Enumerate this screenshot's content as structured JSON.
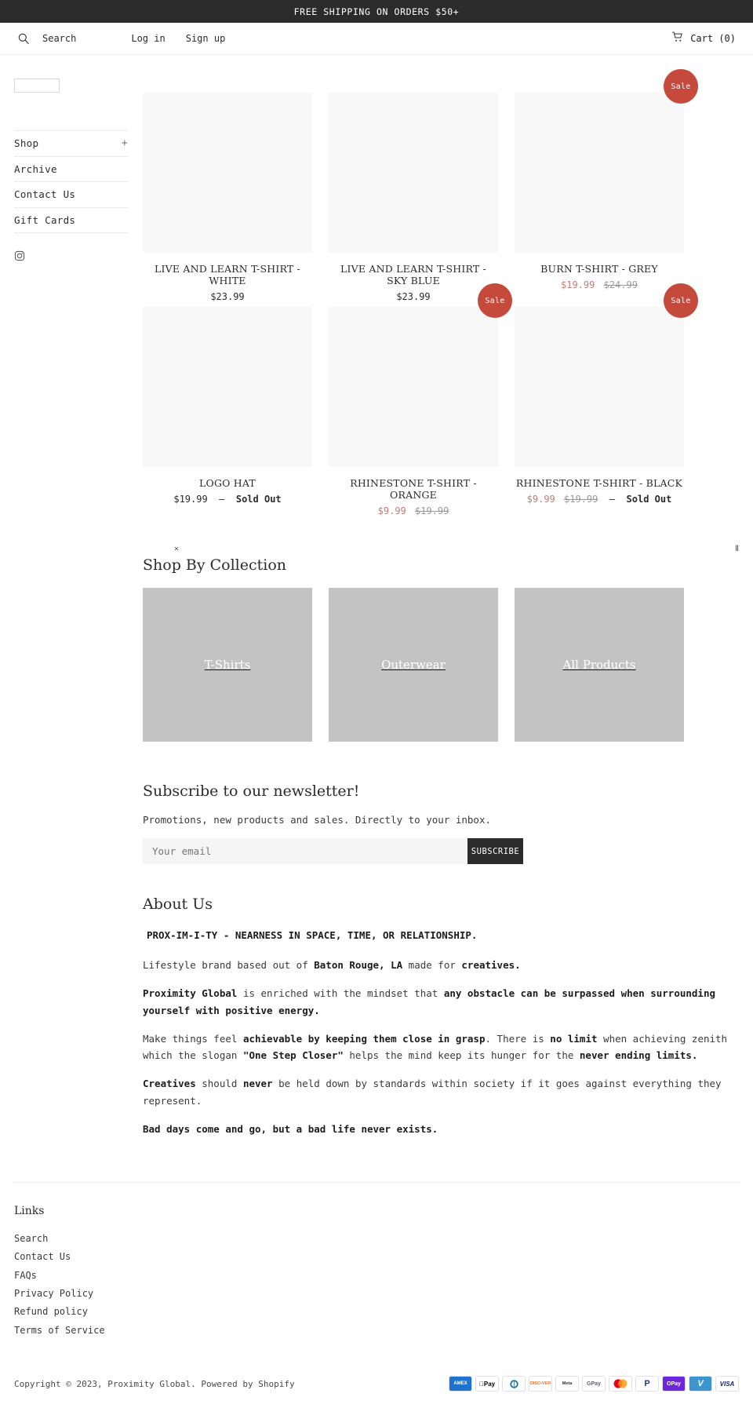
{
  "announcement": {
    "text": "FREE SHIPPING ON ORDERS $50+"
  },
  "topbar": {
    "search_icon": "search-icon",
    "search_label": "Search",
    "login_label": "Log in",
    "signup_label": "Sign up",
    "cart_icon": "cart-icon",
    "cart_label": "Cart (0)"
  },
  "sidebar": {
    "items": [
      {
        "label": "Shop",
        "expander": "+"
      },
      {
        "label": "Archive",
        "expander": ""
      },
      {
        "label": "Contact Us",
        "expander": ""
      },
      {
        "label": "Gift Cards",
        "expander": ""
      }
    ],
    "social": [
      {
        "icon": "instagram-icon",
        "name": "Instagram"
      }
    ]
  },
  "products": [
    {
      "title": "LIVE AND LEARN T-SHIRT - WHITE",
      "price": "$23.99",
      "compare": "",
      "sold_out": "",
      "on_sale": false
    },
    {
      "title": "LIVE AND LEARN T-SHIRT - SKY BLUE",
      "price": "$23.99",
      "compare": "",
      "sold_out": "",
      "on_sale": false
    },
    {
      "title": "BURN T-SHIRT - GREY",
      "price": "$19.99",
      "compare": "$24.99",
      "sold_out": "",
      "on_sale": true
    },
    {
      "title": "LOGO HAT",
      "price": "$19.99",
      "compare": "",
      "sold_out": "Sold Out",
      "on_sale": false
    },
    {
      "title": "RHINESTONE T-SHIRT - ORANGE",
      "price": "$9.99",
      "compare": "$19.99",
      "sold_out": "",
      "on_sale": true
    },
    {
      "title": "RHINESTONE T-SHIRT - BLACK",
      "price": "$9.99",
      "compare": "$19.99",
      "sold_out": "Sold Out",
      "on_sale": true
    }
  ],
  "sale_badge_label": "Sale",
  "slider": {
    "prev_glyph": "✕",
    "pause_glyph": "Ⅱ"
  },
  "collections": {
    "title": "Shop By Collection",
    "tiles": [
      {
        "label": "T-Shirts"
      },
      {
        "label": "Outerwear"
      },
      {
        "label": "All Products"
      }
    ]
  },
  "newsletter": {
    "title": "Subscribe to our newsletter!",
    "subtitle": "Promotions, new products and sales. Directly to your inbox.",
    "placeholder": "Your email",
    "value": "",
    "button": "SUBSCRIBE"
  },
  "about": {
    "title": "About Us",
    "lead": "PROX-IM-I-TY - NEARNESS IN SPACE, TIME, OR RELATIONSHIP.",
    "p1_a": "Lifestyle brand based out of ",
    "p1_b": "Baton Rouge, LA",
    "p1_c": " made for ",
    "p1_d": "creatives.",
    "p2_a": "Proximity Global",
    "p2_b": " is enriched with the mindset that ",
    "p2_c": "any obstacle can be surpassed when surrounding yourself with positive energy.",
    "p3_a": "Make things feel ",
    "p3_b": "achievable by keeping them close in grasp",
    "p3_c": ". There is ",
    "p3_d": "no limit",
    "p3_e": " when achieving zenith which the slogan ",
    "p3_f": "\"One Step Closer\"",
    "p3_g": " helps the mind keep its hunger for the ",
    "p3_h": "never ending limits.",
    "p4_a": "Creatives",
    "p4_b": " should ",
    "p4_c": "never",
    "p4_d": " be held down by standards within society if it goes against everything they represent.",
    "p5": "Bad days come and go, but a bad life never exists."
  },
  "footer": {
    "title": "Links",
    "links": [
      {
        "label": "Search"
      },
      {
        "label": "Contact Us"
      },
      {
        "label": "FAQs"
      },
      {
        "label": "Privacy Policy"
      },
      {
        "label": "Refund policy"
      },
      {
        "label": "Terms of Service"
      }
    ],
    "copyright": "Copyright © 2023, Proximity Global. Powered by Shopify",
    "payments": [
      {
        "name": "amex",
        "label": "AMEX"
      },
      {
        "name": "apple-pay",
        "label": "Pay"
      },
      {
        "name": "diners-club",
        "label": "D"
      },
      {
        "name": "discover",
        "label": "DISC•VER"
      },
      {
        "name": "meta-pay",
        "label": "Meta"
      },
      {
        "name": "google-pay",
        "label": "GPay"
      },
      {
        "name": "mastercard",
        "label": ""
      },
      {
        "name": "paypal",
        "label": "P"
      },
      {
        "name": "openpay",
        "label": "OPay"
      },
      {
        "name": "venmo",
        "label": "V"
      },
      {
        "name": "visa",
        "label": "VISA"
      }
    ]
  },
  "colors": {
    "accent_sale": "#c64a3c",
    "dark": "#2b2b2b",
    "tile": "#c3c3c3",
    "sale_price": "#c07c7c"
  }
}
